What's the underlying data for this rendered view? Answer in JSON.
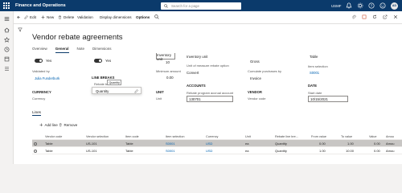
{
  "app": {
    "title": "Finance and Operations",
    "search_placeholder": "Search for a page",
    "company": "USMF",
    "avatar": "AD"
  },
  "actions": {
    "edit": "Edit",
    "new": "New",
    "delete": "Delete",
    "validation": "Validation",
    "display_dimensions": "Display dimensions",
    "options": "Options"
  },
  "page": {
    "title": "Vendor rebate agreements"
  },
  "tabs": [
    "Overview",
    "General",
    "Note",
    "Dimensions"
  ],
  "form": {
    "toggle_value": "Yes",
    "validated_by_label": "Validated by",
    "validated_by": "Julia Funderburk",
    "currency_section": "CURRENCY",
    "currency_label": "Currency",
    "line_breaks_section": "LINE BREAKS",
    "rebate_label": "Rebate br",
    "rebate_value": "Quantity",
    "tooltip": "Quantity",
    "partial_top": "Inventory unit",
    "num_10": "10",
    "unit_conv_label": "Unit of measure rebate option",
    "unit_conv_value": "Convert",
    "min_amount_label": "Minimum amount",
    "min_amount": "0.00",
    "unit_section": "UNIT",
    "unit_label": "Unit",
    "accounts_section": "ACCOUNTS",
    "accrual_label": "Rebate program accrual account",
    "accrual_value": "130701",
    "gross": "Gross",
    "cumulate_label": "Cumulate purchases by",
    "cumulate_value": "Invoice",
    "vendor_section": "VENDOR",
    "vendor_code_label": "Vendor code",
    "item_top": "Table",
    "item_selection_label": "Item selection",
    "item_selection_value": "S0001",
    "date_section": "DATE",
    "start_date_label": "Start date",
    "start_date": "10/15/2021"
  },
  "lines": {
    "title": "Lines",
    "add_line": "Add line",
    "remove": "Remove",
    "columns": [
      "Vendor code",
      "Vendor selection",
      "Item code",
      "Item selection",
      "Currency",
      "Unit",
      "Rebate line bre...",
      "From value",
      "To value",
      "Value",
      "Amou"
    ],
    "rows": [
      [
        "Table",
        "US-101",
        "Table",
        "S0001",
        "USD",
        "ea",
        "Quantity",
        "0.00",
        "1.00",
        "0.00",
        "Amou"
      ],
      [
        "Table",
        "US-101",
        "Table",
        "S0001",
        "USD",
        "ea",
        "Quantity",
        "1.00",
        "10.00",
        "0.00",
        "Amou"
      ]
    ]
  }
}
